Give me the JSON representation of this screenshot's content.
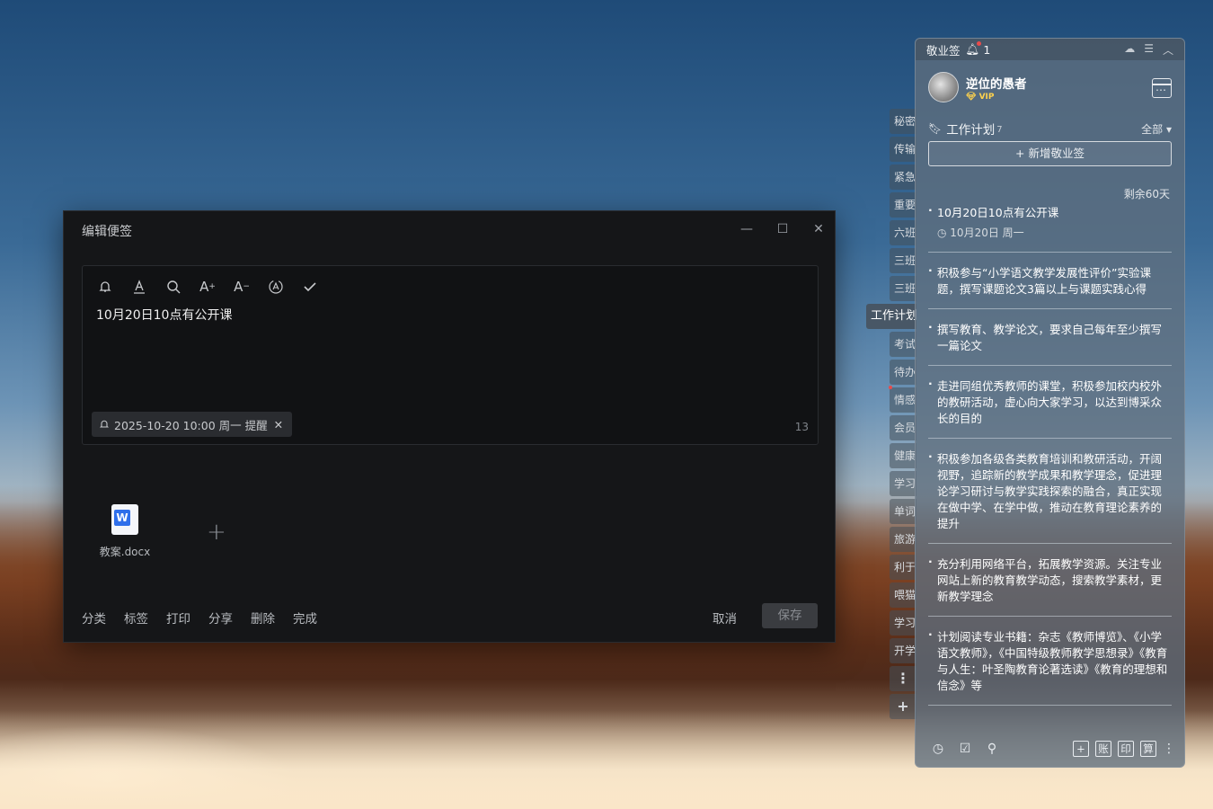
{
  "dialog": {
    "title": "编辑便签",
    "window_controls": [
      "minimize-icon",
      "maximize-icon",
      "close-icon"
    ],
    "toolbar": [
      "bell-icon",
      "font-color-icon",
      "search-icon",
      "font-increase-icon",
      "font-decrease-icon",
      "text-circle-icon",
      "check-icon"
    ],
    "content": "10月20日10点有公开课",
    "reminder": "2025-10-20 10:00 周一 提醒",
    "char_count": "13",
    "attachment": {
      "name": "教案.docx",
      "icon": "W"
    },
    "actions": [
      "分类",
      "标签",
      "打印",
      "分享",
      "删除",
      "完成"
    ],
    "cancel": "取消",
    "save": "保存"
  },
  "side_tabs": [
    "秘密",
    "传输",
    "紧急",
    "重要",
    "六班",
    "三班",
    "三班",
    "工作计划",
    "考试",
    "待办",
    "情感",
    "会员",
    "健康",
    "学习",
    "单词",
    "旅游",
    "利于",
    "喂猫",
    "学习",
    "开学"
  ],
  "side_tab_active": "工作计划",
  "panel": {
    "app_name": "敬业签",
    "notification_count": "1",
    "user_name": "逆位的愚者",
    "vip": "VIP",
    "category": "工作计划",
    "category_count": "7",
    "filter": "全部",
    "new_button": "+ 新增敬业签",
    "days_left": "剩余60天",
    "notes": [
      {
        "text": "10月20日10点有公开课",
        "meta": "10月20日 周一"
      },
      {
        "text": "积极参与“小学语文教学发展性评价”实验课题，撰写课题论文3篇以上与课题实践心得"
      },
      {
        "text": "撰写教育、教学论文，要求自己每年至少撰写一篇论文"
      },
      {
        "text": "走进同组优秀教师的课堂，积极参加校内校外的教研活动，虚心向大家学习，以达到博采众长的目的"
      },
      {
        "text": "积极参加各级各类教育培训和教研活动，开阔视野，追踪新的教学成果和教学理念，促进理论学习研讨与教学实践探索的融合，真正实现在做中学、在学中做，推动在教育理论素养的提升"
      },
      {
        "text": "充分利用网络平台，拓展教学资源。关注专业网站上新的教育教学动态，搜索教学素材，更新教学理念"
      },
      {
        "text": "计划阅读专业书籍：杂志《教师博览》、《小学语文教师》，《中国特级教师教学思想录》《教育与人生：叶圣陶教育论著选读》《教育的理想和信念》等"
      }
    ],
    "footer_left": [
      "clock-icon",
      "checkbox-icon",
      "search-icon"
    ],
    "footer_right": [
      "+",
      "账",
      "印",
      "算"
    ]
  }
}
